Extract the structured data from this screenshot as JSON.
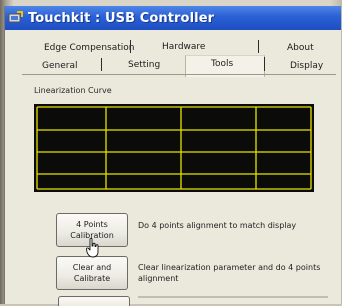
{
  "window": {
    "title": "Touchkit : USB Controller",
    "title_bar_color": "#2a5fd6",
    "icon": "touchkit-app-icon"
  },
  "tabs": {
    "row1": [
      {
        "label": "Edge Compensation"
      },
      {
        "label": "Hardware"
      },
      {
        "label": "About"
      }
    ],
    "row2": [
      {
        "label": "General"
      },
      {
        "label": "Setting"
      },
      {
        "label": "Tools",
        "selected": true
      },
      {
        "label": "Display"
      }
    ]
  },
  "linearization": {
    "group_label": "Linearization Curve",
    "panel_color": "#0b0b09",
    "grid_color": "#e8e300",
    "grid_columns": 4,
    "grid_rows": 4
  },
  "actions": [
    {
      "button_label_line1": "4 Points",
      "button_label_line2": "Calibration",
      "description": "Do 4 points alignment to match display"
    },
    {
      "button_label_line1": "Clear and",
      "button_label_line2": "Calibrate",
      "description": "Clear linearization parameter and do 4 points alignment"
    }
  ],
  "cursor": {
    "icon": "hand-pointer-icon"
  }
}
